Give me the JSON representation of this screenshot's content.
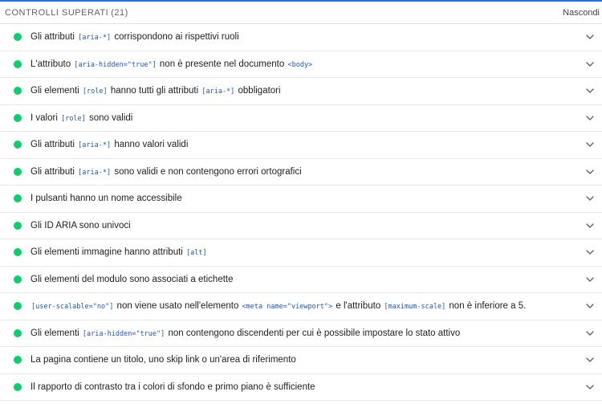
{
  "group": {
    "title": "CONTROLLI SUPERATI",
    "count": "(21)",
    "toggle_label": "Nascondi"
  },
  "audits": [
    {
      "name": "aria-allowed-attr",
      "parts": [
        {
          "t": "text",
          "v": "Gli attributi "
        },
        {
          "t": "code",
          "v": "[aria-*]"
        },
        {
          "t": "text",
          "v": " corrispondono ai rispettivi ruoli"
        }
      ]
    },
    {
      "name": "aria-hidden-body",
      "parts": [
        {
          "t": "text",
          "v": "L'attributo "
        },
        {
          "t": "code",
          "v": "[aria-hidden=\"true\"]"
        },
        {
          "t": "text",
          "v": " non è presente nel documento "
        },
        {
          "t": "code",
          "v": "<body>"
        }
      ]
    },
    {
      "name": "aria-required-attr",
      "parts": [
        {
          "t": "text",
          "v": "Gli elementi "
        },
        {
          "t": "code",
          "v": "[role]"
        },
        {
          "t": "text",
          "v": " hanno tutti gli attributi "
        },
        {
          "t": "code",
          "v": "[aria-*]"
        },
        {
          "t": "text",
          "v": " obbligatori"
        }
      ]
    },
    {
      "name": "aria-roles",
      "parts": [
        {
          "t": "text",
          "v": "I valori "
        },
        {
          "t": "code",
          "v": "[role]"
        },
        {
          "t": "text",
          "v": " sono validi"
        }
      ]
    },
    {
      "name": "aria-valid-attr-value",
      "parts": [
        {
          "t": "text",
          "v": "Gli attributi "
        },
        {
          "t": "code",
          "v": "[aria-*]"
        },
        {
          "t": "text",
          "v": " hanno valori validi"
        }
      ]
    },
    {
      "name": "aria-valid-attr",
      "parts": [
        {
          "t": "text",
          "v": "Gli attributi "
        },
        {
          "t": "code",
          "v": "[aria-*]"
        },
        {
          "t": "text",
          "v": " sono validi e non contengono errori ortografici"
        }
      ]
    },
    {
      "name": "button-name",
      "parts": [
        {
          "t": "text",
          "v": "I pulsanti hanno un nome accessibile"
        }
      ]
    },
    {
      "name": "duplicate-id-aria",
      "parts": [
        {
          "t": "text",
          "v": "Gli ID ARIA sono univoci"
        }
      ]
    },
    {
      "name": "image-alt",
      "parts": [
        {
          "t": "text",
          "v": "Gli elementi immagine hanno attributi "
        },
        {
          "t": "code",
          "v": "[alt]"
        }
      ]
    },
    {
      "name": "label",
      "parts": [
        {
          "t": "text",
          "v": "Gli elementi del modulo sono associati a etichette"
        }
      ]
    },
    {
      "name": "meta-viewport",
      "parts": [
        {
          "t": "code",
          "v": "[user-scalable=\"no\"]"
        },
        {
          "t": "text",
          "v": " non viene usato nell'elemento "
        },
        {
          "t": "code",
          "v": "<meta name=\"viewport\">"
        },
        {
          "t": "text",
          "v": " e l'attributo "
        },
        {
          "t": "code",
          "v": "[maximum-scale]"
        },
        {
          "t": "text",
          "v": " non è inferiore a 5."
        }
      ]
    },
    {
      "name": "aria-hidden-focus",
      "parts": [
        {
          "t": "text",
          "v": "Gli elementi "
        },
        {
          "t": "code",
          "v": "[aria-hidden=\"true\"]"
        },
        {
          "t": "text",
          "v": " non contengono discendenti per cui è possibile impostare lo stato attivo"
        }
      ]
    },
    {
      "name": "bypass",
      "parts": [
        {
          "t": "text",
          "v": "La pagina contiene un titolo, uno skip link o un'area di riferimento"
        }
      ]
    },
    {
      "name": "color-contrast",
      "parts": [
        {
          "t": "text",
          "v": "Il rapporto di contrasto tra i colori di sfondo e primo piano è sufficiente"
        }
      ]
    }
  ],
  "colors": {
    "pass": "#0cce6b",
    "code": "#1a57c7",
    "accent": "#1a73e8"
  },
  "icons": {
    "status": "pass-dot-icon",
    "expand": "chevron-down-icon"
  }
}
